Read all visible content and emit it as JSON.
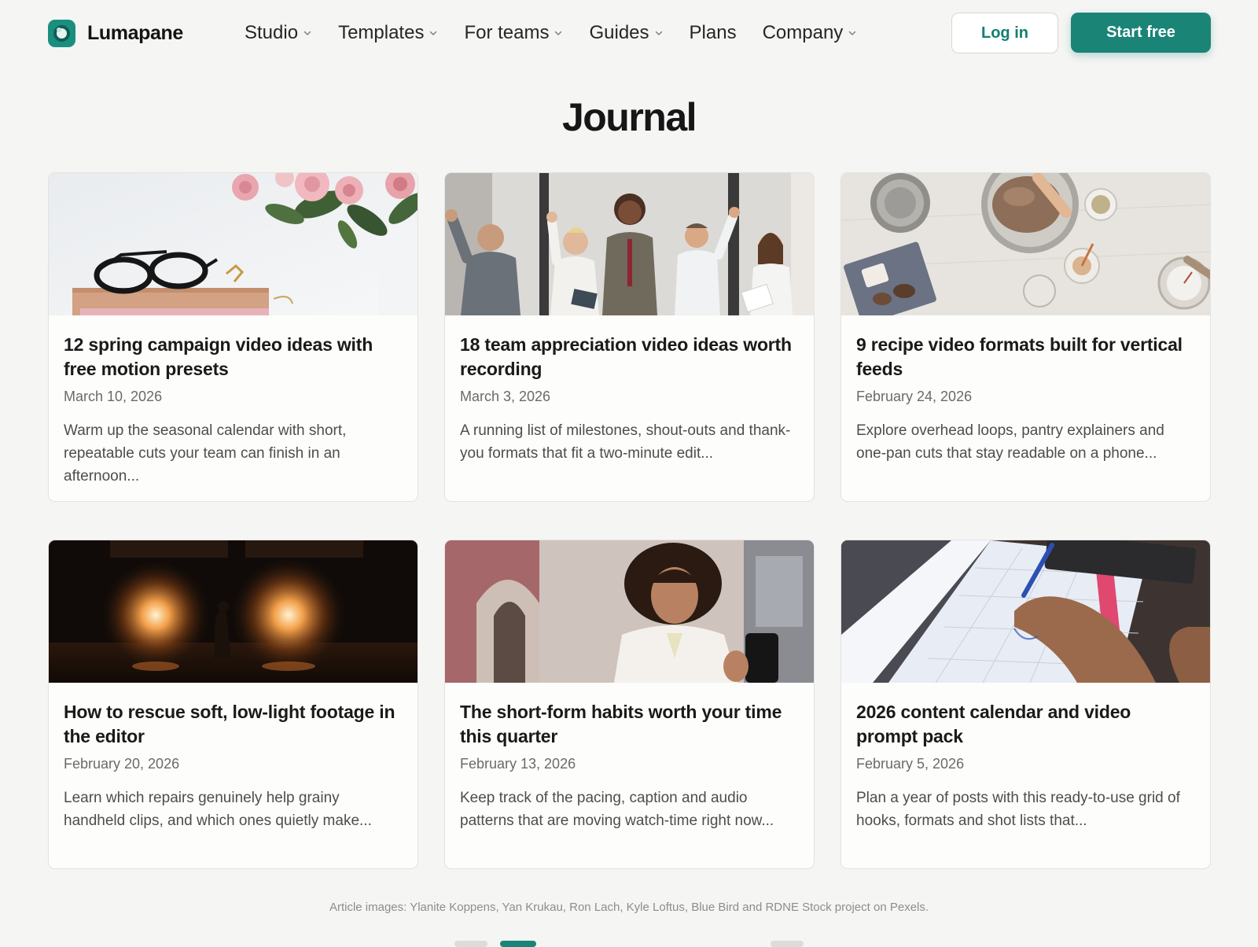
{
  "brand": {
    "name": "Lumapane",
    "accent": "#1a8477"
  },
  "nav": [
    {
      "label": "Studio",
      "has_menu": true
    },
    {
      "label": "Templates",
      "has_menu": true
    },
    {
      "label": "For teams",
      "has_menu": true
    },
    {
      "label": "Guides",
      "has_menu": true
    },
    {
      "label": "Plans",
      "has_menu": false
    },
    {
      "label": "Company",
      "has_menu": true
    }
  ],
  "auth": {
    "login": "Log in",
    "start": "Start free"
  },
  "page": {
    "title": "Journal"
  },
  "articles": [
    {
      "title": "12 spring campaign video ideas with free motion presets",
      "date": "March 10, 2026",
      "excerpt": "Warm up the seasonal calendar with short, repeatable cuts your team can finish in an afternoon..."
    },
    {
      "title": "18 team appreciation video ideas worth recording",
      "date": "March 3, 2026",
      "excerpt": "A running list of milestones, shout-outs and thank-you formats that fit a two-minute edit..."
    },
    {
      "title": "9 recipe video formats built for vertical feeds",
      "date": "February 24, 2026",
      "excerpt": "Explore overhead loops, pantry explainers and one-pan cuts that stay readable on a phone..."
    },
    {
      "title": "How to rescue soft, low-light footage in the editor",
      "date": "February 20, 2026",
      "excerpt": "Learn which repairs genuinely help grainy handheld clips, and which ones quietly make..."
    },
    {
      "title": "The short-form habits worth your time this quarter",
      "date": "February 13, 2026",
      "excerpt": "Keep track of the pacing, caption and audio patterns that are moving watch-time right now..."
    },
    {
      "title": "2026 content calendar and video prompt pack",
      "date": "February 5, 2026",
      "excerpt": "Plan a year of posts with this ready-to-use grid of hooks, formats and shot lists that..."
    }
  ],
  "footer": {
    "credit": "Article images: Ylanite Koppens, Yan Krukau, Ron Lach, Kyle Loftus, Blue Bird and RDNE Stock project on Pexels."
  }
}
